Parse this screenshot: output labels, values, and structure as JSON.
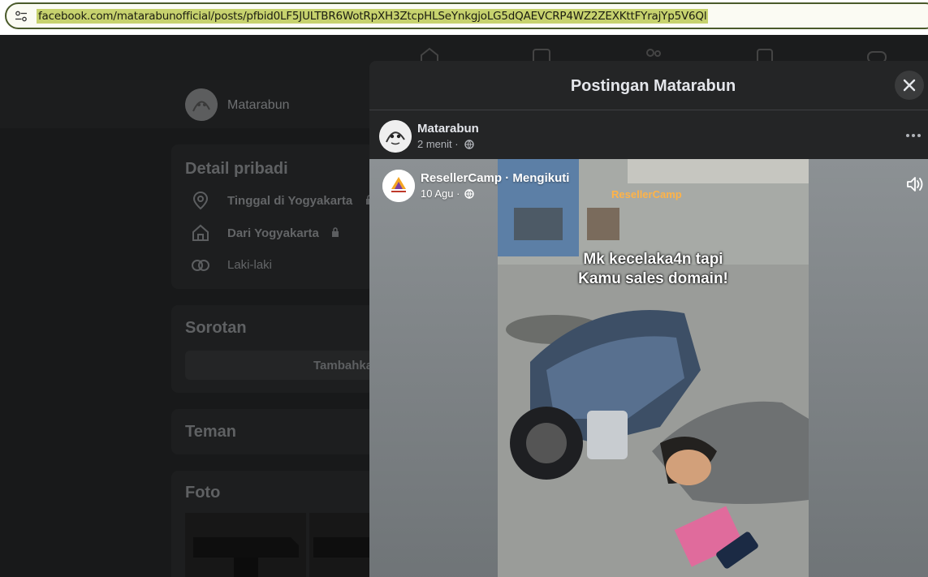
{
  "browser": {
    "url": "facebook.com/matarabunofficial/posts/pfbid0LF5JULTBR6WotRpXH3ZtcpHLSeYnkgjoLG5dQAEVCRP4WZ2ZEXKttFYrajYp5V6Ql",
    "site_info_icon": "tune-icon"
  },
  "background_page": {
    "profile_name": "Matarabun",
    "details": {
      "title": "Detail pribadi",
      "items": [
        {
          "icon": "location-pin-icon",
          "text": "Tinggal di Yogyakarta",
          "locked": true
        },
        {
          "icon": "home-icon",
          "text": "Dari Yogyakarta",
          "locked": true
        },
        {
          "icon": "gender-icon",
          "text": "Laki-laki",
          "locked": false
        }
      ]
    },
    "highlights": {
      "title": "Sorotan",
      "button_label": "Tambahka"
    },
    "friends": {
      "title": "Teman"
    },
    "photos": {
      "title": "Foto"
    }
  },
  "modal": {
    "title": "Postingan Matarabun",
    "post": {
      "author": "Matarabun",
      "time": "2 menit",
      "separator": "·",
      "privacy_icon": "globe-icon"
    },
    "shared": {
      "page_name": "ResellerCamp",
      "follow_text": "Mengikuti",
      "date": "10 Agu",
      "video": {
        "logo_text": "ResellerCamp",
        "caption_line1": "Mk kecelaka4n tapi",
        "caption_line2": "Kamu sales domain!"
      }
    }
  }
}
